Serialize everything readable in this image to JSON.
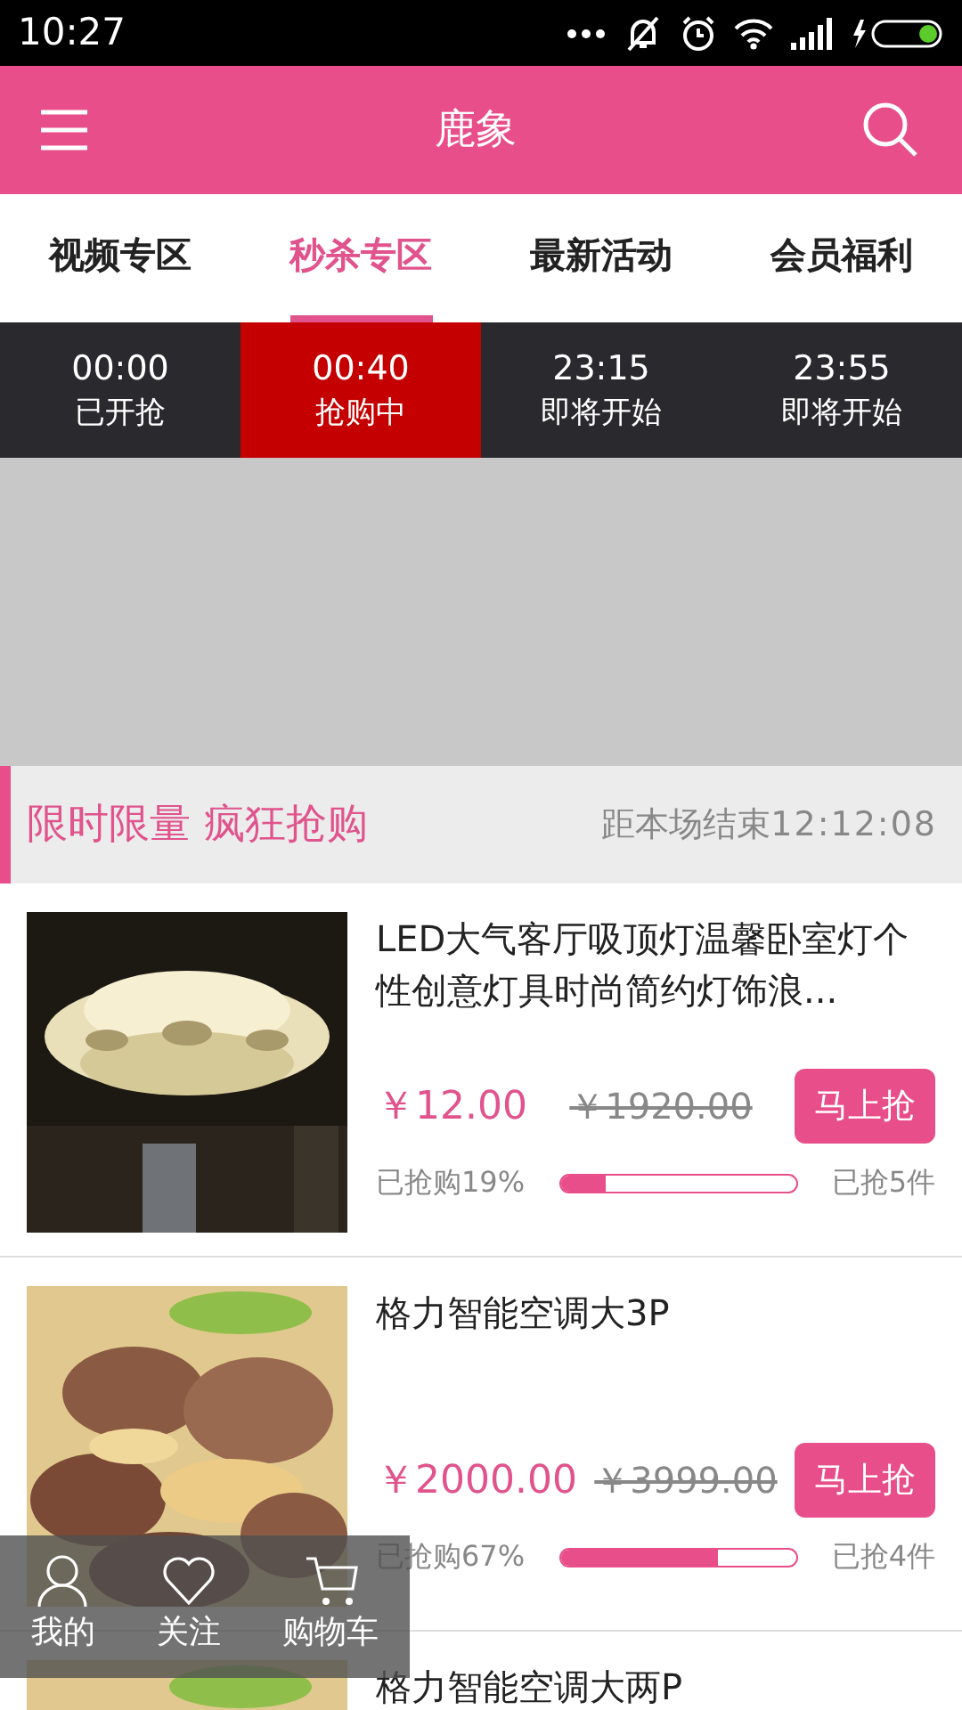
{
  "status_bar": {
    "time": "10:27"
  },
  "header": {
    "title": "鹿象"
  },
  "tabs": [
    {
      "label": "视频专区",
      "selected": false
    },
    {
      "label": "秒杀专区",
      "selected": true
    },
    {
      "label": "最新活动",
      "selected": false
    },
    {
      "label": "会员福利",
      "selected": false
    }
  ],
  "time_slots": [
    {
      "time": "00:00",
      "status": "已开抢",
      "selected": false
    },
    {
      "time": "00:40",
      "status": "抢购中",
      "selected": true
    },
    {
      "time": "23:15",
      "status": "即将开始",
      "selected": false
    },
    {
      "time": "23:55",
      "status": "即将开始",
      "selected": false
    }
  ],
  "section": {
    "title": "限时限量 疯狂抢购",
    "countdown_label": "距本场结束",
    "countdown": "12:12:08"
  },
  "products": [
    {
      "title": "LED大气客厅吸顶灯温馨卧室灯个性创意灯具时尚简约灯饰浪...",
      "price": "￥12.00",
      "original_price": "￥1920.00",
      "button": "马上抢",
      "sold_percent": "已抢购19%",
      "level": 0.19,
      "sold_count": "已抢5件"
    },
    {
      "title": "格力智能空调大3P",
      "price": "￥2000.00",
      "original_price": "￥3999.00",
      "button": "马上抢",
      "sold_percent": "已抢购67%",
      "level": 0.67,
      "sold_count": "已抢4件"
    },
    {
      "title": "格力智能空调大两P"
    }
  ],
  "bottom_nav": [
    {
      "label": "我的",
      "kind": "user"
    },
    {
      "label": "关注",
      "kind": "heart"
    },
    {
      "label": "购物车",
      "kind": "cart"
    }
  ]
}
